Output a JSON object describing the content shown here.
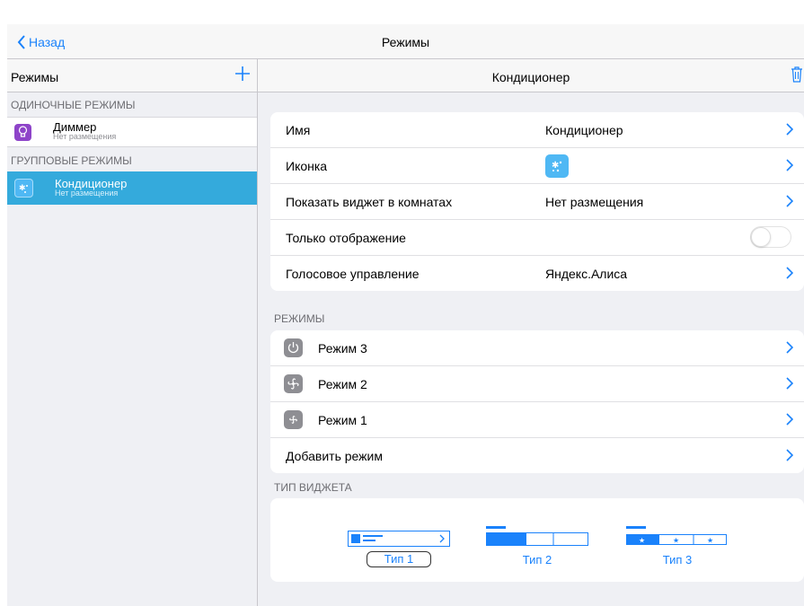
{
  "nav": {
    "back_label": "Назад",
    "title": "Режимы"
  },
  "sidebar": {
    "title": "Режимы",
    "sections": [
      {
        "header": "ОДИНОЧНЫЕ РЕЖИМЫ",
        "items": [
          {
            "title": "Диммер",
            "subtitle": "Нет размещения",
            "icon": "lightbulb-icon",
            "icon_color": "#8e44c9",
            "selected": false
          }
        ]
      },
      {
        "header": "ГРУППОВЫЕ РЕЖИМЫ",
        "items": [
          {
            "title": "Кондиционер",
            "subtitle": "Нет размещения",
            "icon": "snowflake-icon",
            "icon_color": "#4fb8f4",
            "selected": true
          }
        ]
      }
    ]
  },
  "detail": {
    "title": "Кондиционер",
    "properties": [
      {
        "label": "Имя",
        "value": "Кондиционер"
      },
      {
        "label": "Иконка",
        "value_icon": "snowflake-icon"
      },
      {
        "label": "Показать виджет в комнатах",
        "value": "Нет размещения"
      },
      {
        "label": "Только отображение",
        "toggle": false
      },
      {
        "label": "Голосовое управление",
        "value": "Яндекс.Алиса"
      }
    ],
    "modes_header": "РЕЖИМЫ",
    "modes": [
      {
        "label": "Режим 3",
        "icon": "power-icon"
      },
      {
        "label": "Режим 2",
        "icon": "fan-icon"
      },
      {
        "label": "Режим 1",
        "icon": "fan-icon"
      }
    ],
    "add_mode_label": "Добавить режим",
    "widget_header": "ТИП ВИДЖЕТА",
    "widget_types": [
      {
        "label": "Тип 1",
        "selected": true
      },
      {
        "label": "Тип 2",
        "selected": false
      },
      {
        "label": "Тип 3",
        "selected": false
      }
    ]
  },
  "colors": {
    "accent": "#1a82fb",
    "selection": "#34aadc",
    "background": "#eff0f4"
  }
}
